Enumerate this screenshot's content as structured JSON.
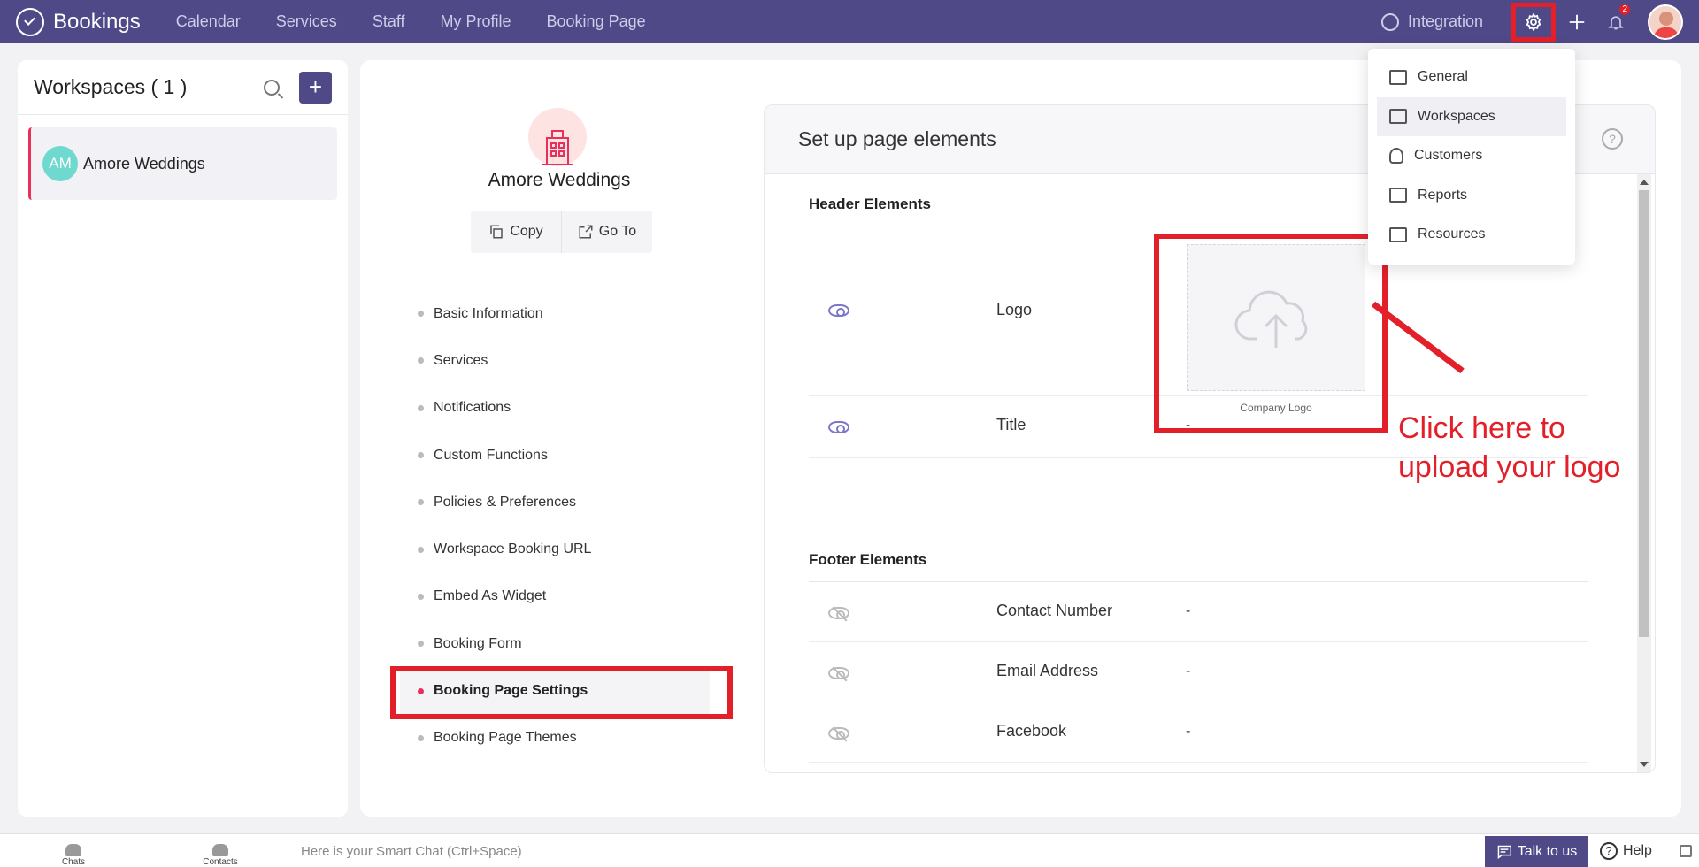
{
  "nav": {
    "brand": "Bookings",
    "links": [
      "Calendar",
      "Services",
      "Staff",
      "My Profile",
      "Booking Page"
    ],
    "integration": "Integration",
    "notification_count": "2"
  },
  "workspaces": {
    "title": "Workspaces ( 1 )",
    "add_label": "+",
    "items": [
      {
        "initials": "AM",
        "name": "Amore Weddings"
      }
    ]
  },
  "workspace_detail": {
    "name": "Amore Weddings",
    "copy_label": "Copy",
    "goto_label": "Go To",
    "menu": [
      "Basic Information",
      "Services",
      "Notifications",
      "Custom Functions",
      "Policies & Preferences",
      "Workspace Booking URL",
      "Embed As Widget",
      "Booking Form",
      "Booking Page Settings",
      "Booking Page Themes"
    ],
    "active_menu": "Booking Page Settings"
  },
  "setup": {
    "title": "Set up page elements",
    "help": "?",
    "header_section": "Header Elements",
    "header_rows": [
      {
        "label": "Logo",
        "value": "",
        "visible": true
      },
      {
        "label": "Title",
        "value": "-",
        "visible": true
      }
    ],
    "logo_caption": "Company Logo",
    "footer_section": "Footer Elements",
    "footer_rows": [
      {
        "label": "Contact Number",
        "value": "-",
        "visible": false
      },
      {
        "label": "Email Address",
        "value": "-",
        "visible": false
      },
      {
        "label": "Facebook",
        "value": "-",
        "visible": false
      }
    ]
  },
  "annotation": {
    "line1": "Click here to",
    "line2": "upload your logo"
  },
  "settings_menu": {
    "items": [
      "General",
      "Workspaces",
      "Customers",
      "Reports",
      "Resources"
    ],
    "selected": "Workspaces"
  },
  "bottombar": {
    "chats": "Chats",
    "contacts": "Contacts",
    "smart_chat_placeholder": "Here is your Smart Chat (Ctrl+Space)",
    "talk": "Talk to us",
    "help": "Help"
  },
  "colors": {
    "brand": "#4f4a87",
    "highlight": "#e3202a",
    "active_dot": "#e8315a"
  }
}
